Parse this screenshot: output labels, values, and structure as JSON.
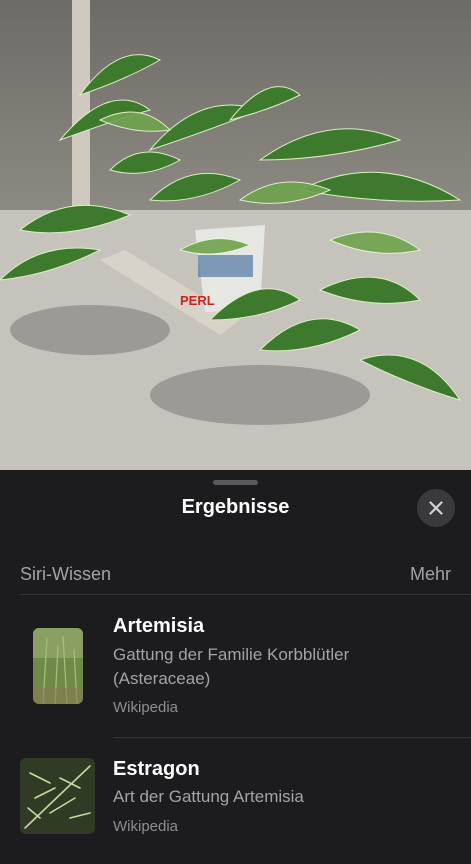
{
  "sheet": {
    "title": "Ergebnisse",
    "close_icon": "close-icon"
  },
  "section": {
    "title": "Siri-Wissen",
    "more_label": "Mehr"
  },
  "results": [
    {
      "title": "Artemisia",
      "description": "Gattung der Familie Korbblütler (Asteraceae)",
      "source": "Wikipedia"
    },
    {
      "title": "Estragon",
      "description": "Art der Gattung Artemisia",
      "source": "Wikipedia"
    }
  ],
  "photo": {
    "pot_label": "PERL"
  }
}
